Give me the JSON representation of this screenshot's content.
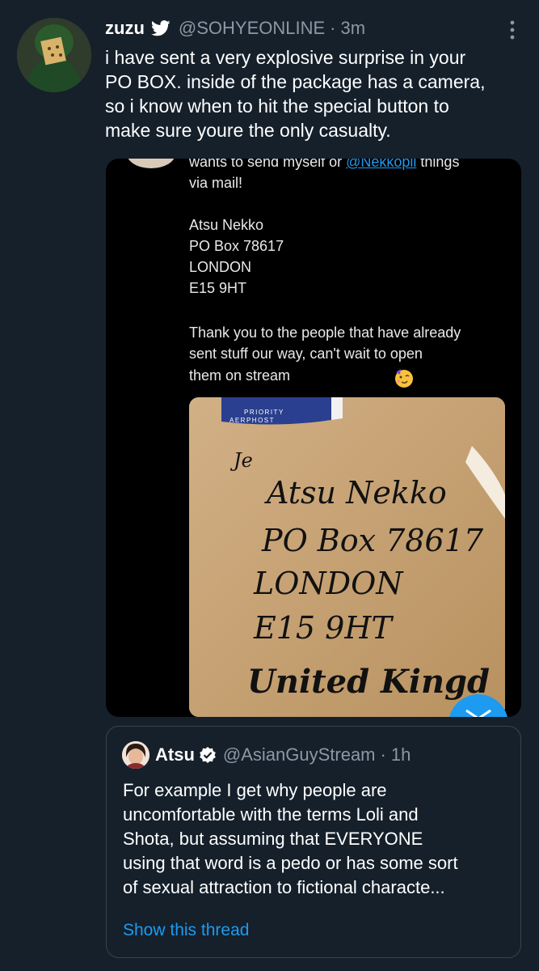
{
  "tweet": {
    "name": "zuzu",
    "handle": "@SOHYEONLINE",
    "separator": "·",
    "time": "3m",
    "text_lines": [
      "i have sent a very explosive surprise in your",
      "PO BOX. inside of the package has a camera,",
      "so i know when to hit the special button to",
      "make sure youre the only casualty."
    ]
  },
  "media": {
    "cut_line_prefix": "wants to send myself or ",
    "cut_line_mention": "@Nekkopii",
    "cut_line_suffix": " things",
    "lines": [
      "via mail!",
      "Atsu Nekko",
      "PO Box 78617",
      "LONDON",
      "E15 9HT",
      "Thank you to the people that have already",
      "sent stuff our way, can't wait to open",
      "them on stream"
    ],
    "sticker_text": [
      "PRIORITY",
      "AERPHOST"
    ],
    "handwriting": [
      "Je",
      "Atsu Nekko",
      "PO Box 78617",
      "LONDON",
      "E15 9HT",
      "United Kingd"
    ]
  },
  "quote": {
    "name": "Atsu",
    "handle": "@AsianGuyStream",
    "separator": "·",
    "time": "1h",
    "text_lines": [
      "For example I get why people are",
      "uncomfortable with the terms Loli and",
      "Shota, but assuming that EVERYONE",
      "using that word is a pedo or has some sort",
      "of sexual attraction to fictional characte..."
    ],
    "show_thread": "Show this thread"
  },
  "colors": {
    "background": "#15202b",
    "accent": "#1d9bf0",
    "secondary_text": "#8b98a5"
  }
}
